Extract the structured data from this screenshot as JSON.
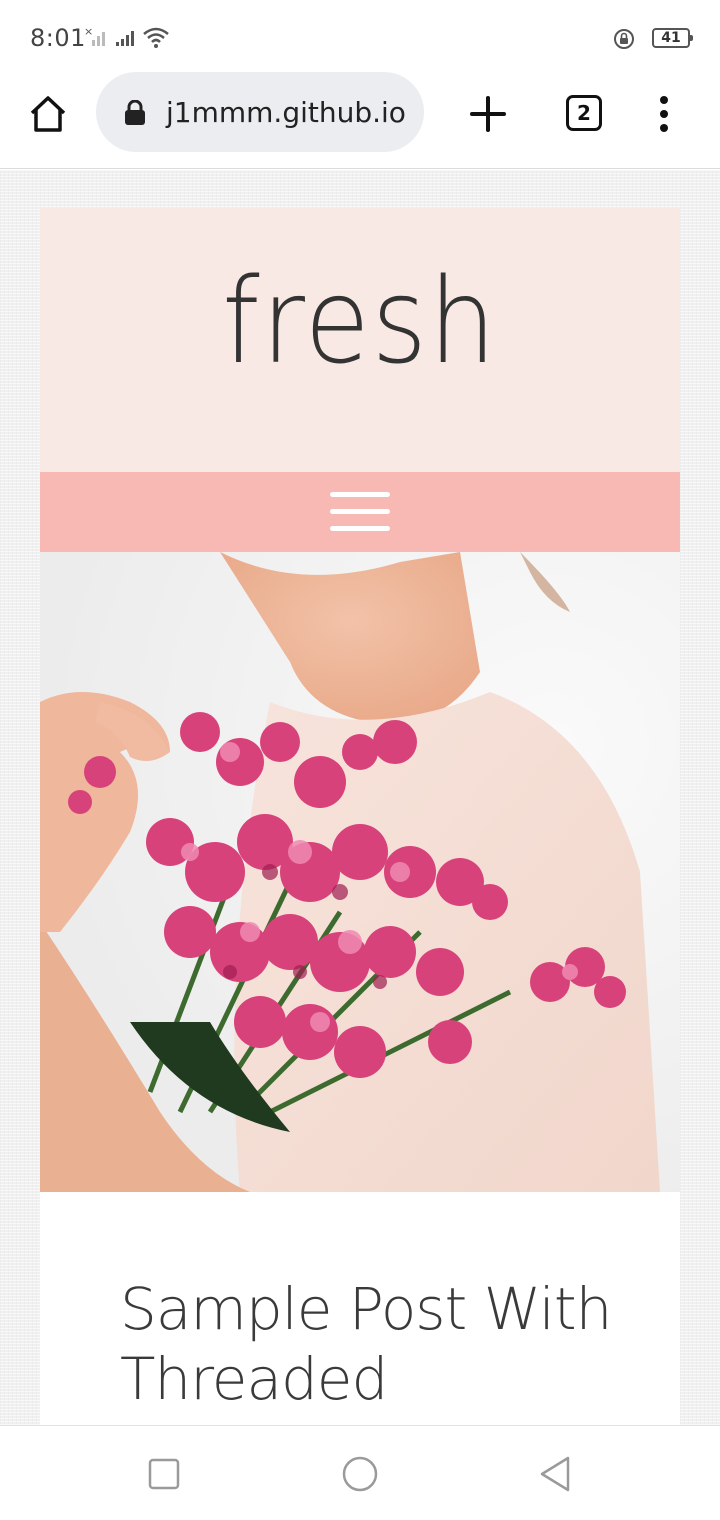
{
  "status_bar": {
    "time": "8:01",
    "battery_level": "41",
    "icons": [
      "no-sim-signal-icon",
      "signal-icon",
      "wifi-icon",
      "rotation-lock-icon",
      "battery-icon"
    ]
  },
  "browser": {
    "url": "j1mmm.github.io",
    "tab_count": "2",
    "icons": [
      "home-icon",
      "lock-icon",
      "new-tab-plus-icon",
      "tab-switcher-icon",
      "overflow-menu-icon"
    ]
  },
  "page": {
    "site_title": "fresh",
    "menu_icon": "hamburger-menu-icon",
    "hero_image": "woman-holding-pink-flower-bouquet",
    "post_title": "Sample Post With Threaded",
    "colors": {
      "header_bg": "#f8e9e5",
      "nav_bg": "#f8b8b3",
      "page_bg": "#f0f0f0",
      "flower_pink": "#d8427a"
    }
  },
  "nav_bar": {
    "icons": [
      "recents-square-icon",
      "home-circle-icon",
      "back-triangle-icon"
    ]
  }
}
